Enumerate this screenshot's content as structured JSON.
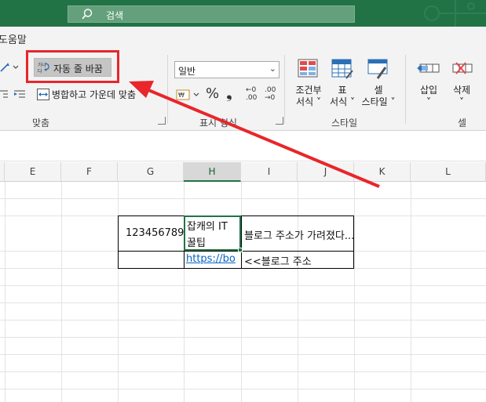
{
  "titlebar": {
    "search_label": "검색",
    "search_icon": "search-icon",
    "color": "#217346"
  },
  "tabs": {
    "help_label": "도움말"
  },
  "ribbon": {
    "alignment": {
      "wrap_text_label": "자동 줄 바꿈",
      "wrap_icon_text": "가나다",
      "merge_center_label": "병합하고 가운데 맞춤",
      "group_label": "맞춤"
    },
    "number": {
      "format_value": "일반",
      "group_label": "표시 형식",
      "percent": "%",
      "comma": "❟",
      "inc_decimal_top": "←0",
      "inc_decimal_bottom": ".00",
      "dec_decimal_top": ".00",
      "dec_decimal_bottom": "→0"
    },
    "styles": {
      "conditional_label_1": "조건부",
      "conditional_label_2": "서식 ˅",
      "table_label_1": "표",
      "table_label_2": "서식 ˅",
      "cell_styles_label_1": "셀",
      "cell_styles_label_2": "스타일 ˅",
      "group_label": "스타일"
    },
    "cells": {
      "insert_label": "삽입",
      "delete_label": "삭제",
      "caret": "˅",
      "group_label": "셀"
    }
  },
  "grid": {
    "columns": [
      "E",
      "F",
      "G",
      "H",
      "I",
      "J",
      "K",
      "L"
    ],
    "selected_column": "H",
    "cells": {
      "g_row1": "123456789",
      "h_row1_line1": "잡캐의 IT",
      "h_row1_line2": "꿀팁",
      "i_row1": "블로그 주소가 가려졌다...",
      "h_row2": "https://bo",
      "i_row2": "<<블로그 주소"
    }
  },
  "annotation": {
    "color": "#e8262b"
  }
}
